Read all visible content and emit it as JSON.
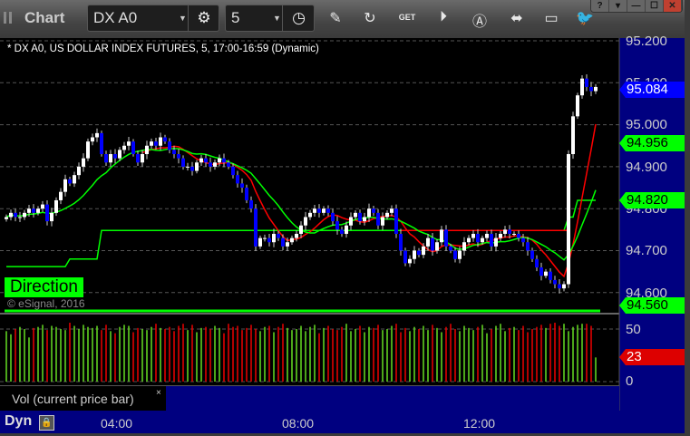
{
  "window": {
    "title": "Chart",
    "symbol": "DX A0",
    "interval": "5",
    "buttons": [
      "help",
      "restore-menu",
      "minimize",
      "maximize",
      "close"
    ],
    "win_glyphs": [
      "?",
      "▾",
      "—",
      "☐",
      "✕"
    ]
  },
  "toolbar": {
    "icons": [
      "settings-gear-icon",
      "clock-icon",
      "pencil-icon",
      "study-icon",
      "get-icon",
      "play-icon",
      "alert-icon",
      "link-icon",
      "chat-icon",
      "twitter-icon"
    ]
  },
  "chart": {
    "description": "* DX A0, US DOLLAR INDEX FUTURES, 5, 17:00-16:59 (Dynamic)",
    "direction_label": "Direction",
    "copyright": "© eSignal, 2016",
    "vol_label": "Vol (current price bar)",
    "vol_close": "×",
    "dyn": "Dyn",
    "colors": {
      "up": "#ffffff",
      "down": "#0000ff",
      "ma_fast": "#ff0000",
      "ma_slow": "#00ff00",
      "direction": "#00ff00",
      "vol_up": "#66dd22",
      "vol_down": "#ee0000",
      "axis_bg": "#000080"
    }
  },
  "chart_data": {
    "type": "candlestick",
    "price_ticks": [
      "95.200",
      "95.100",
      "95.000",
      "94.900",
      "94.800",
      "94.700",
      "94.600"
    ],
    "price_tick_values": [
      95.2,
      95.1,
      95.0,
      94.9,
      94.8,
      94.7,
      94.6
    ],
    "last_price": "95.084",
    "ma_slow_value": "94.956",
    "direction_value": "94.820",
    "direction_base": "94.560",
    "vol_ticks": [
      "50",
      "0"
    ],
    "vol_tick_values": [
      50,
      0
    ],
    "last_volume": "23",
    "time_ticks": [
      "04:00",
      "08:00",
      "12:00"
    ],
    "ylim": [
      94.56,
      95.24
    ],
    "closes": [
      94.78,
      94.79,
      94.78,
      94.78,
      94.79,
      94.8,
      94.79,
      94.8,
      94.81,
      94.77,
      94.79,
      94.82,
      94.84,
      94.87,
      94.86,
      94.88,
      94.9,
      94.92,
      94.96,
      94.97,
      94.98,
      94.93,
      94.91,
      94.93,
      94.92,
      94.94,
      94.95,
      94.96,
      94.93,
      94.91,
      94.93,
      94.95,
      94.96,
      94.95,
      94.97,
      94.96,
      94.94,
      94.93,
      94.92,
      94.9,
      94.9,
      94.89,
      94.91,
      94.92,
      94.91,
      94.9,
      94.91,
      94.92,
      94.91,
      94.9,
      94.88,
      94.86,
      94.85,
      94.82,
      94.8,
      94.71,
      94.73,
      94.73,
      94.72,
      94.74,
      94.73,
      94.71,
      94.72,
      94.73,
      94.74,
      94.76,
      94.78,
      94.79,
      94.8,
      94.79,
      94.8,
      94.79,
      94.77,
      94.75,
      94.74,
      94.76,
      94.78,
      94.79,
      94.77,
      94.78,
      94.8,
      94.79,
      94.76,
      94.78,
      94.79,
      94.8,
      94.74,
      94.7,
      94.67,
      94.68,
      94.7,
      94.69,
      94.71,
      94.73,
      94.7,
      94.72,
      94.75,
      94.71,
      94.7,
      94.68,
      94.7,
      94.72,
      94.73,
      94.74,
      94.72,
      94.73,
      94.74,
      94.71,
      94.73,
      94.74,
      94.75,
      94.74,
      94.74,
      94.73,
      94.72,
      94.7,
      94.68,
      94.66,
      94.64,
      94.65,
      94.63,
      94.62,
      94.61,
      94.62,
      94.93,
      95.02,
      95.07,
      95.11,
      95.09,
      95.08,
      95.09
    ],
    "volume": [
      48,
      45,
      50,
      52,
      50,
      42,
      51,
      52,
      54,
      49,
      53,
      52,
      50,
      49,
      56,
      53,
      50,
      54,
      52,
      51,
      53,
      49,
      54,
      48,
      46,
      52,
      54,
      53,
      47,
      51,
      50,
      49,
      52,
      55,
      51,
      50,
      52,
      48,
      53,
      55,
      49,
      54,
      47,
      51,
      52,
      50,
      53,
      51,
      46,
      55,
      52,
      53,
      49,
      51,
      54,
      50,
      48,
      52,
      53,
      47,
      52,
      55,
      51,
      49,
      50,
      53,
      48,
      52,
      54,
      46,
      51,
      53,
      50,
      49,
      52,
      55,
      48,
      50,
      53,
      47,
      52,
      51,
      54,
      49,
      50,
      53,
      55,
      47,
      51,
      48,
      52,
      50,
      53,
      49,
      54,
      51,
      47,
      52,
      55,
      50,
      48,
      53,
      51,
      49,
      52,
      54,
      46,
      50,
      53,
      55,
      48,
      51,
      52,
      49,
      53,
      47,
      50,
      52,
      54,
      51,
      55,
      56,
      53,
      55,
      48,
      52,
      54,
      55,
      55,
      53,
      23
    ]
  }
}
